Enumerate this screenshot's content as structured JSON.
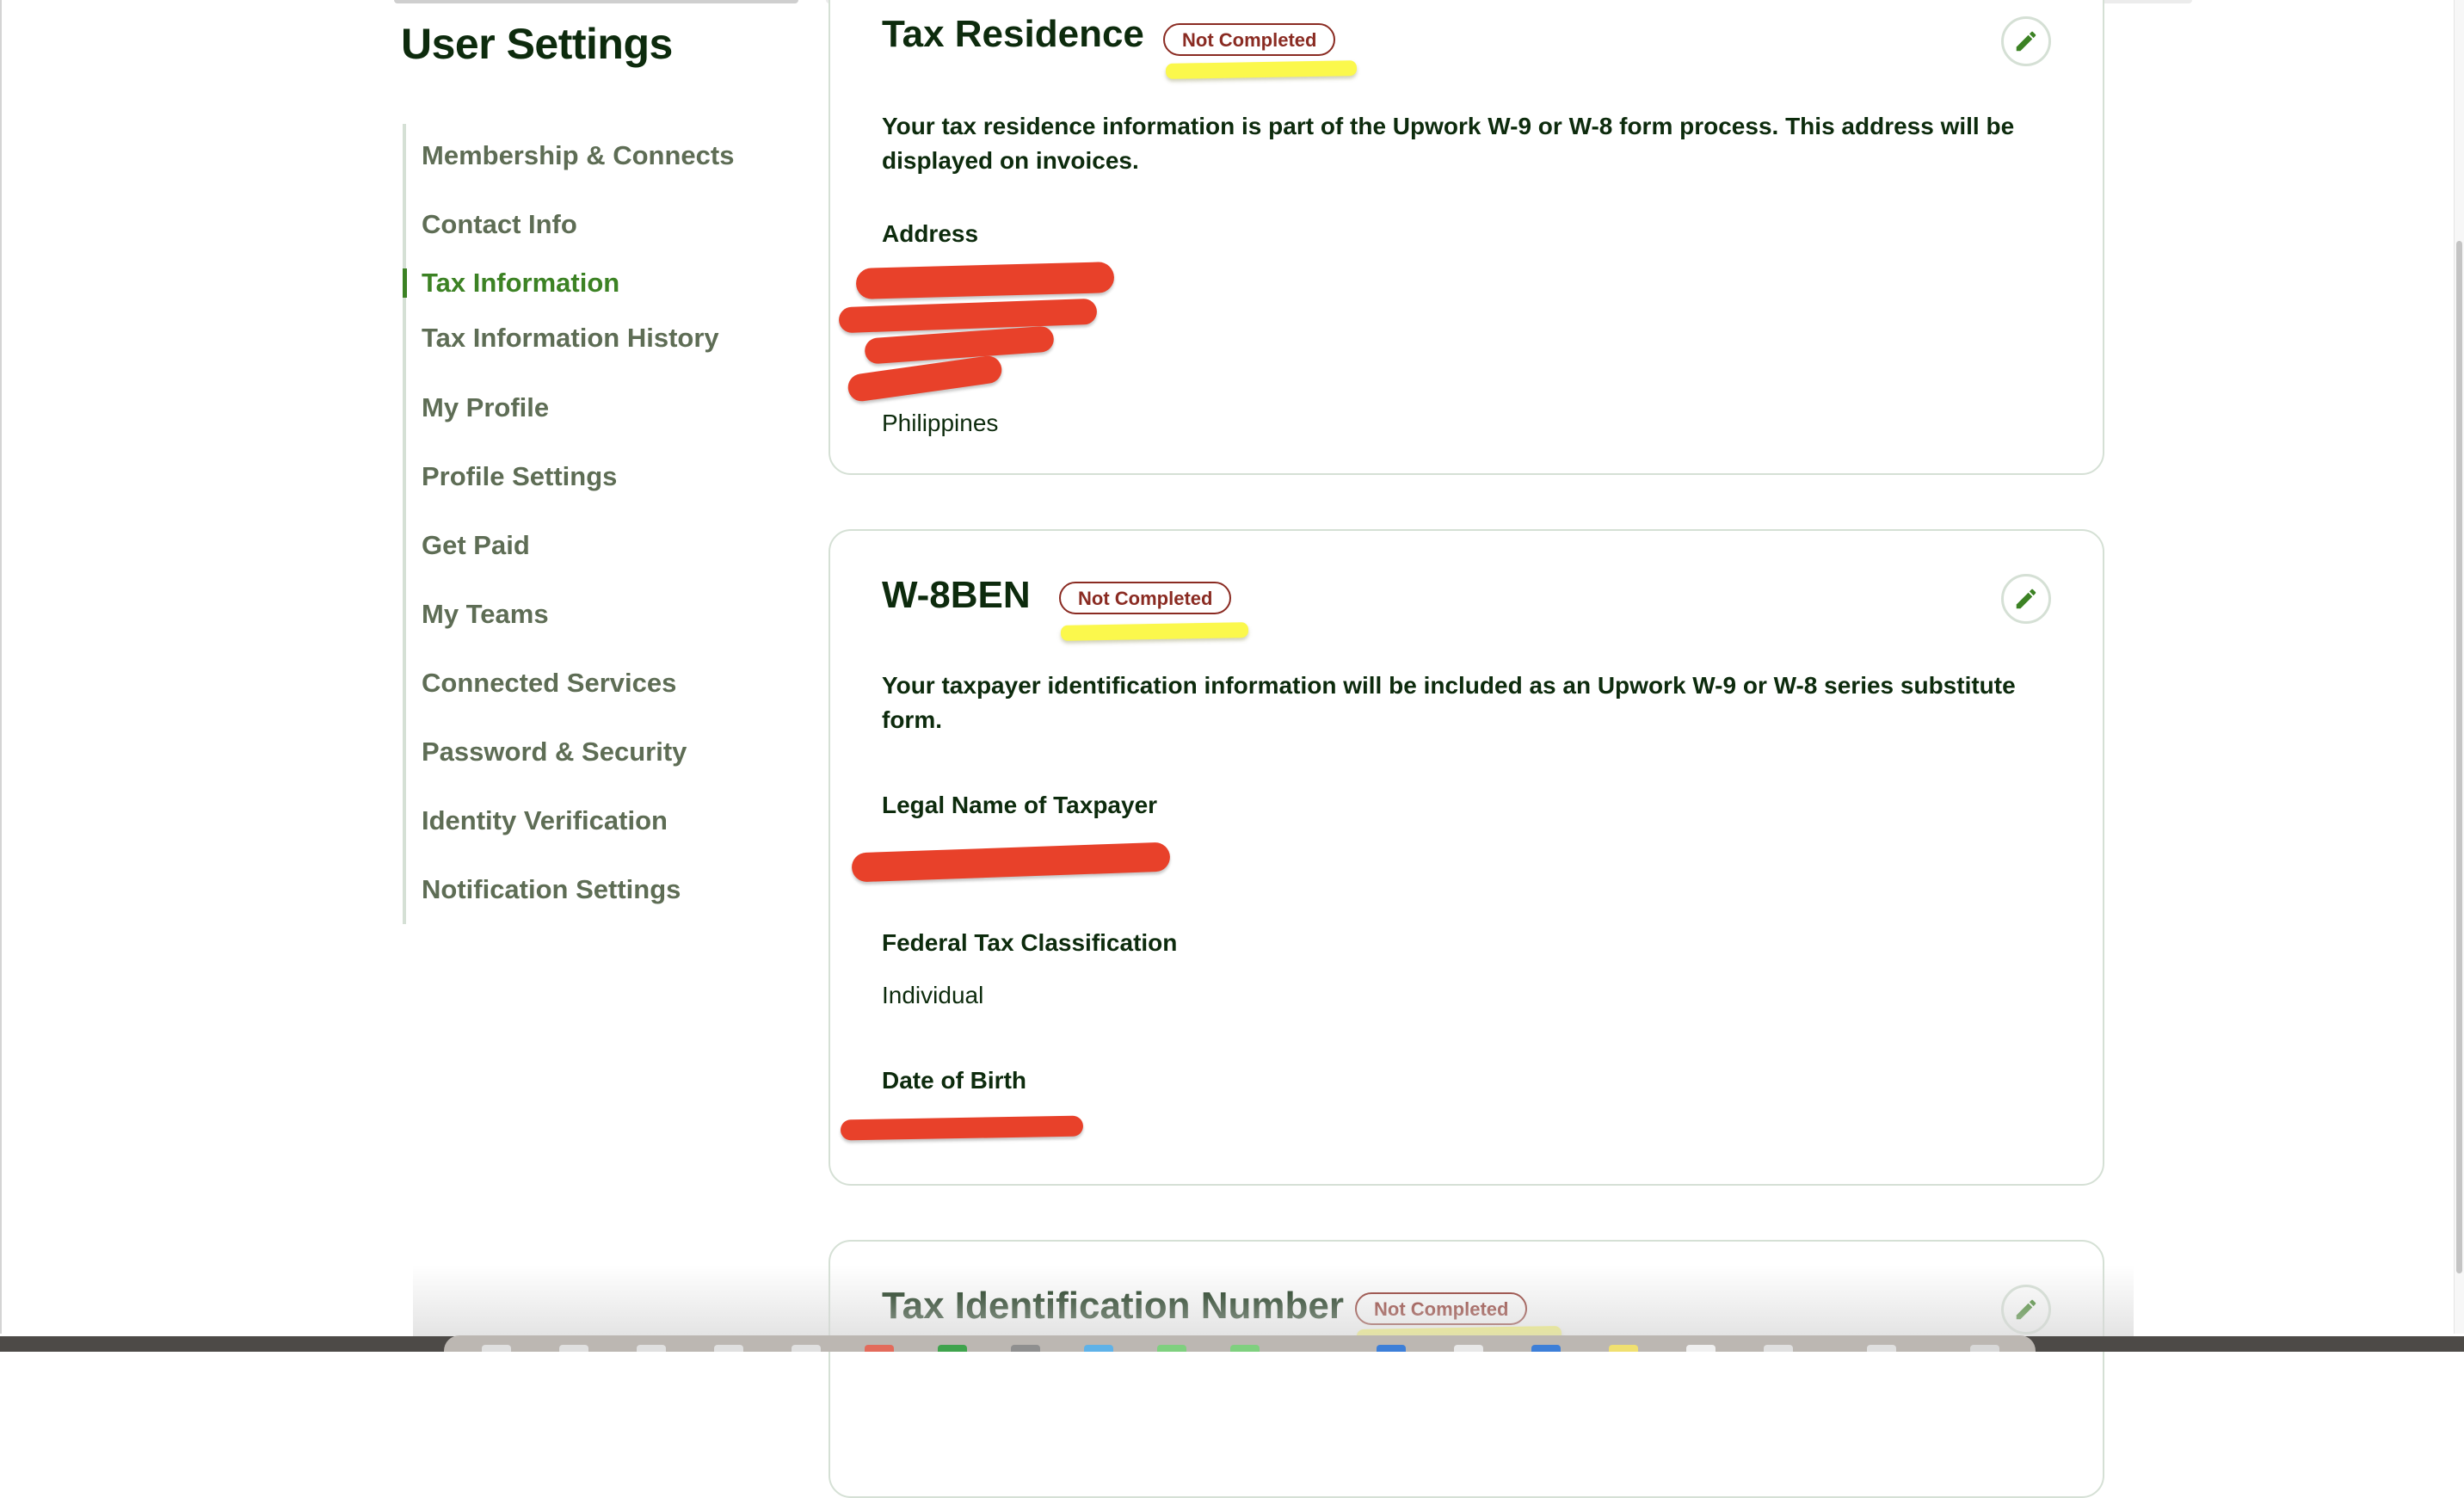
{
  "page": {
    "title": "User Settings"
  },
  "sidebar": {
    "items": [
      {
        "label": "Membership & Connects",
        "active": false
      },
      {
        "label": "Contact Info",
        "active": false
      },
      {
        "label": "Tax Information",
        "active": true
      },
      {
        "label": "Tax Information History",
        "active": false
      },
      {
        "label": "My Profile",
        "active": false
      },
      {
        "label": "Profile Settings",
        "active": false
      },
      {
        "label": "Get Paid",
        "active": false
      },
      {
        "label": "My Teams",
        "active": false
      },
      {
        "label": "Connected Services",
        "active": false
      },
      {
        "label": "Password & Security",
        "active": false
      },
      {
        "label": "Identity Verification",
        "active": false
      },
      {
        "label": "Notification Settings",
        "active": false
      }
    ]
  },
  "cards": {
    "tax_residence": {
      "title": "Tax Residence",
      "status": "Not Completed",
      "edit_icon": "pencil-icon",
      "description": "Your tax residence information is part of the Upwork W-9 or W-8 form process. This address will be displayed on invoices.",
      "address_label": "Address",
      "address_country": "Philippines",
      "address_lines_redacted": true
    },
    "w8ben": {
      "title": "W-8BEN",
      "status": "Not Completed",
      "edit_icon": "pencil-icon",
      "description": "Your taxpayer identification information will be included as an Upwork W-9 or W-8 series substitute form.",
      "legal_name_label": "Legal Name of Taxpayer",
      "legal_name_redacted": true,
      "classification_label": "Federal Tax Classification",
      "classification_value": "Individual",
      "dob_label": "Date of Birth",
      "dob_redacted": true
    },
    "tin": {
      "title": "Tax Identification Number",
      "status": "Not Completed",
      "edit_icon": "pencil-icon"
    }
  },
  "colors": {
    "accent_green": "#3c8224",
    "status_red": "#8a2b22",
    "highlight_yellow": "#fbf84c",
    "redaction_red": "#e8412a",
    "text_dark": "#0d2b0d",
    "sidebar_text": "#5e6d55"
  }
}
